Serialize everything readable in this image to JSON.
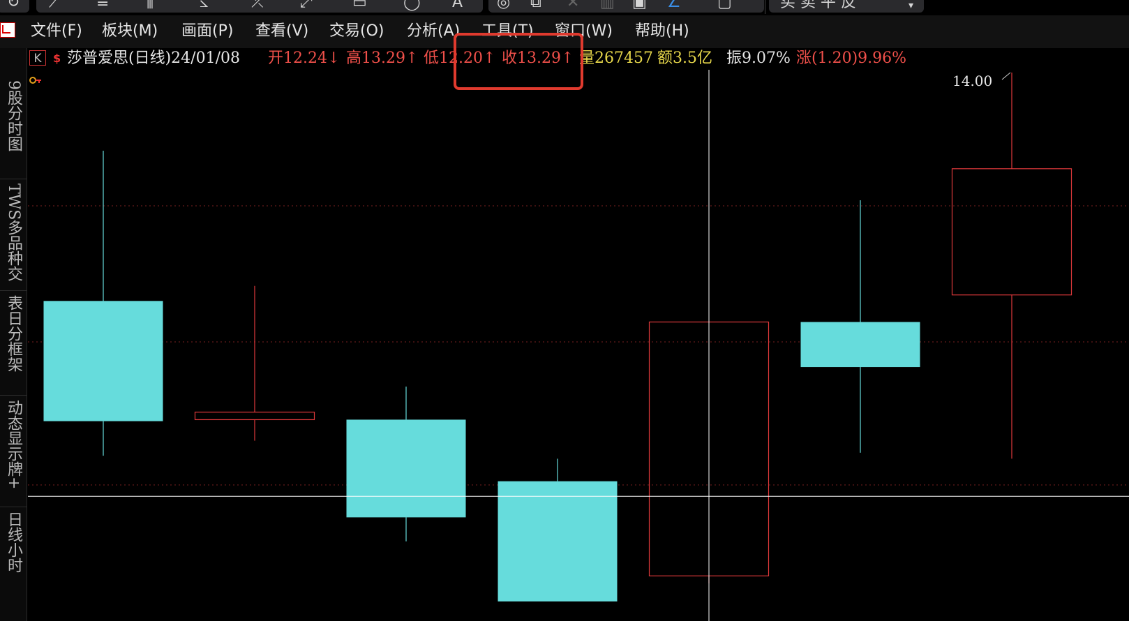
{
  "toolbar": {
    "icons": [
      "refresh-icon",
      "pen-icon",
      "line-icon",
      "bars-icon",
      "fan-icon",
      "cross-line-icon",
      "diagonal-icon",
      "rect-icon",
      "circle-icon",
      "text-icon",
      "target-icon",
      "copy-icon",
      "delete-icon",
      "trash-icon",
      "lock-icon",
      "select-line-icon",
      "square-icon"
    ],
    "right_text": "买  卖  平  反"
  },
  "menu": {
    "items": [
      "文件(F)",
      "板块(M)",
      "画面(P)",
      "查看(V)",
      "交易(O)",
      "分析(A)",
      "工具(T)",
      "窗口(W)",
      "帮助(H)"
    ]
  },
  "lefttabs": [
    "9股分时图",
    "TWS多品种交",
    "表日分框架",
    "动态显示牌+",
    "日线小时"
  ],
  "infobar": {
    "k_label": "K",
    "s_icon": "$",
    "title": "莎普爱思(日线)24/01/08",
    "open": "开12.24↓",
    "high": "高13.29↑",
    "low": "低12.20↑",
    "close": "收13.29↑",
    "volume": "量267457",
    "amount": "额3.5亿",
    "amplitude": "振9.07%",
    "change": "涨(1.20)9.96%"
  },
  "chart_data": {
    "type": "candlestick",
    "price_label": "14.00",
    "colors": {
      "up": "#e0393b",
      "down": "#66dcdc",
      "crosshair": "#ffffff",
      "grid": "#7a1f1f"
    },
    "candles": [
      {
        "open": 12.2,
        "close": 11.4,
        "high": 13.2,
        "low": 11.17,
        "direction": "down"
      },
      {
        "open": 11.41,
        "close": 11.46,
        "high": 12.3,
        "low": 11.27,
        "direction": "up"
      },
      {
        "open": 11.41,
        "close": 10.76,
        "high": 11.63,
        "low": 10.6,
        "direction": "down"
      },
      {
        "open": 11.0,
        "close": 10.2,
        "high": 11.15,
        "low": 10.2,
        "direction": "down"
      },
      {
        "open": 10.37,
        "close": 12.06,
        "high": 12.06,
        "low": 10.32,
        "direction": "up"
      },
      {
        "open": 12.06,
        "close": 11.76,
        "high": 12.87,
        "low": 11.19,
        "direction": "down"
      },
      {
        "open": 12.24,
        "close": 13.08,
        "high": 13.72,
        "low": 11.15,
        "direction": "up"
      }
    ],
    "crosshair": {
      "x_index": 4,
      "price": 10.9
    }
  }
}
